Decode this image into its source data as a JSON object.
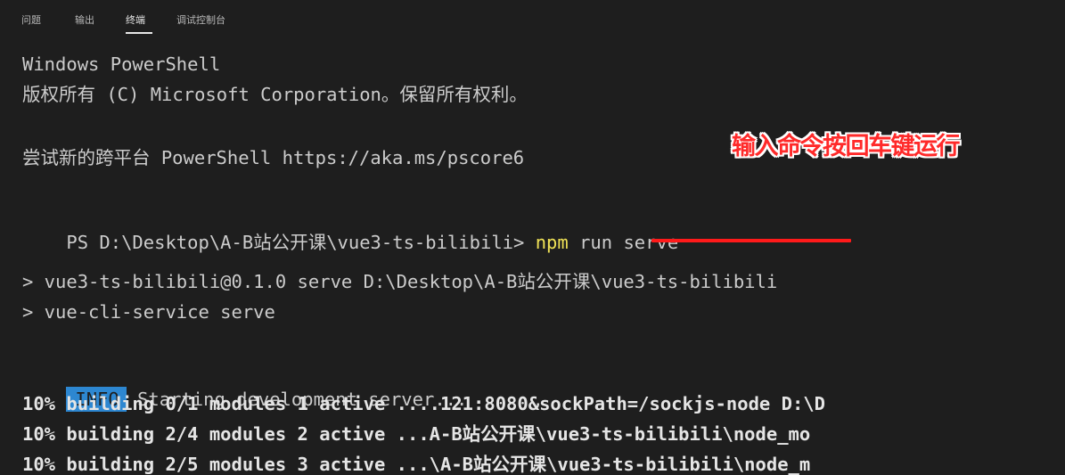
{
  "panel": {
    "tabs": [
      {
        "label": "问题",
        "active": false
      },
      {
        "label": "输出",
        "active": false
      },
      {
        "label": "终端",
        "active": true
      },
      {
        "label": "调试控制台",
        "active": false
      }
    ]
  },
  "terminal": {
    "lines": {
      "header_title": "Windows PowerShell",
      "copyright": "版权所有 (C) Microsoft Corporation。保留所有权利。",
      "try_new": "尝试新的跨平台 PowerShell https://aka.ms/pscore6",
      "prompt": "PS D:\\Desktop\\A-B站公开课\\vue3-ts-bilibili> ",
      "command_npm": "npm",
      "command_rest": " run serve",
      "output_1": "> vue3-ts-bilibili@0.1.0 serve D:\\Desktop\\A-B站公开课\\vue3-ts-bilibili",
      "output_2": "> vue-cli-service serve",
      "info_badge": "INFO",
      "info_text": " Starting development server...",
      "build_1": "10% building 0/1 modules 1 active ....121:8080&sockPath=/sockjs-node D:\\D",
      "build_2": "10% building 2/4 modules 2 active ...A-B站公开课\\vue3-ts-bilibili\\node_mo",
      "build_3": "10% building 2/5 modules 3 active ...\\A-B站公开课\\vue3-ts-bilibili\\node_m"
    },
    "annotation": "输入命令按回车键运行",
    "colors": {
      "background": "#1e1e1e",
      "text": "#cccccc",
      "npm_highlight": "#f0e256",
      "info_badge": "#2d87d1",
      "annotation": "#ff2a2a",
      "underline": "#ff1a1a"
    }
  }
}
